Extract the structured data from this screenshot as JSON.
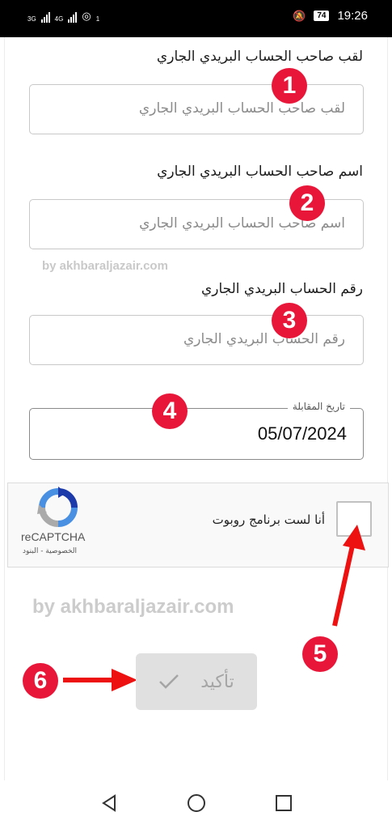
{
  "status_bar": {
    "signal_1": "3G",
    "signal_2": "4G",
    "hotspot_count": "1",
    "battery": "74",
    "time": "19:26"
  },
  "form": {
    "last_name": {
      "label": "لقب صاحب الحساب البريدي الجاري",
      "placeholder": "لقب صاحب الحساب البريدي الجاري"
    },
    "first_name": {
      "label": "اسم صاحب الحساب البريدي الجاري",
      "placeholder": "اسم صاحب الحساب البريدي الجاري"
    },
    "account_number": {
      "label": "رقم الحساب البريدي الجاري",
      "placeholder": "رقم الحساب البريدي الجاري"
    },
    "interview_date": {
      "legend": "تاريخ المقابلة",
      "value": "05/07/2024"
    },
    "confirm_label": "تأكيد"
  },
  "recaptcha": {
    "checkbox_label": "أنا لست برنامج روبوت",
    "brand": "reCAPTCHA",
    "links": "الخصوصية - البنود"
  },
  "annotations": {
    "badges": [
      "1",
      "2",
      "3",
      "4",
      "5",
      "6"
    ],
    "watermark_small": "by akhbaraljazair.com",
    "watermark_large": "by akhbaraljazair.com",
    "badge_color": "#e8173a"
  },
  "icons": {
    "confirm": "checkmark-icon",
    "nav": [
      "back-icon",
      "home-icon",
      "recents-icon"
    ]
  }
}
